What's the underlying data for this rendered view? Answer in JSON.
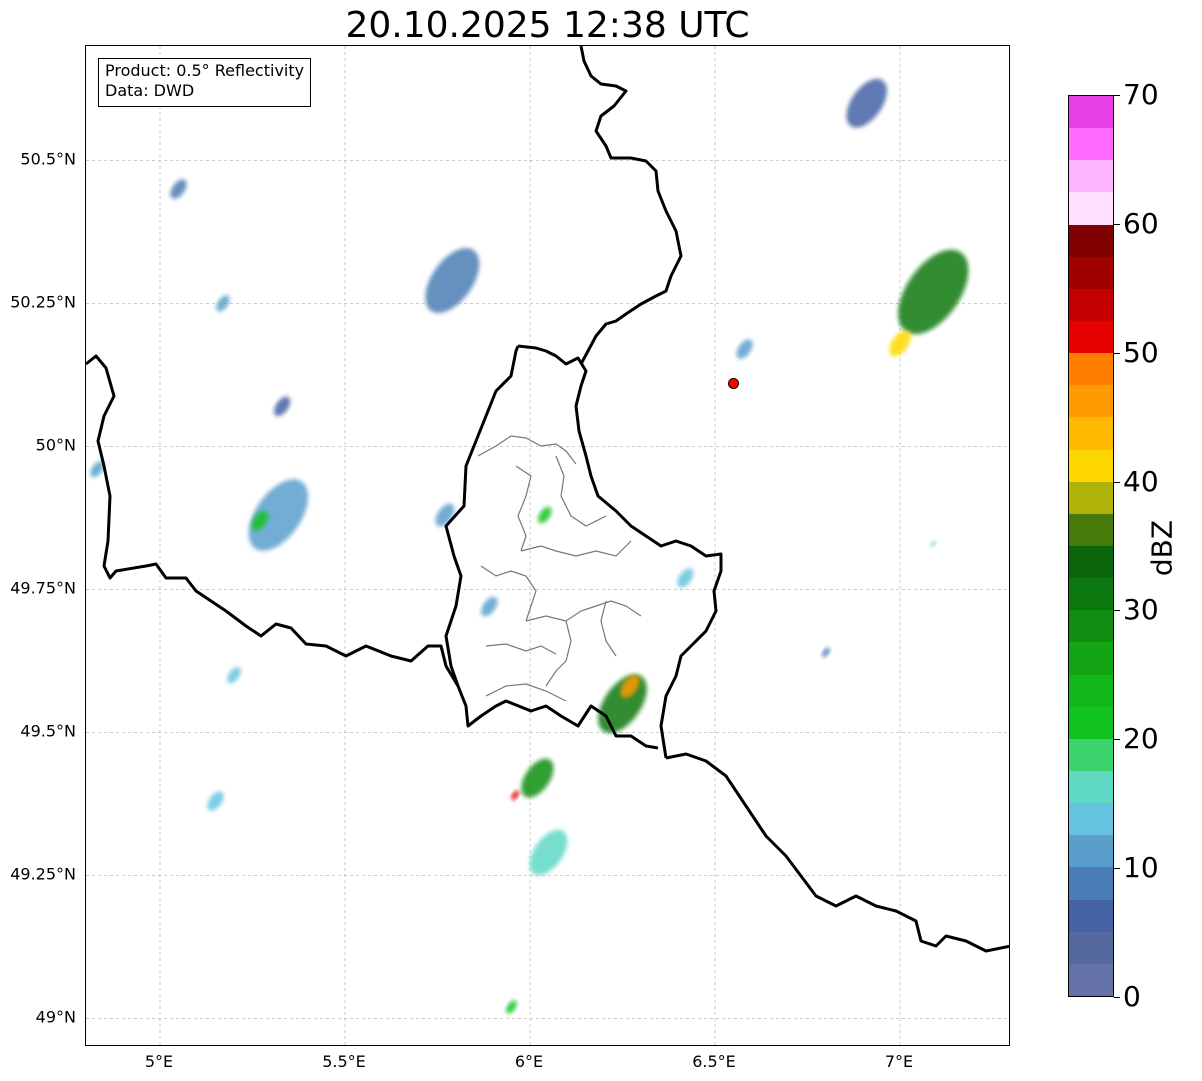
{
  "title": "20.10.2025 12:38 UTC",
  "info_box": {
    "line1": "Product: 0.5° Reflectivity",
    "line2": "Data: DWD"
  },
  "axes": {
    "lon_range": [
      4.8,
      7.3
    ],
    "lat_range": [
      48.95,
      50.7
    ],
    "lon_ticks": [
      {
        "value": 5.0,
        "label": "5°E"
      },
      {
        "value": 5.5,
        "label": "5.5°E"
      },
      {
        "value": 6.0,
        "label": "6°E"
      },
      {
        "value": 6.5,
        "label": "6.5°E"
      },
      {
        "value": 7.0,
        "label": "7°E"
      }
    ],
    "lat_ticks": [
      {
        "value": 49.0,
        "label": "49°N"
      },
      {
        "value": 49.25,
        "label": "49.25°N"
      },
      {
        "value": 49.5,
        "label": "49.5°N"
      },
      {
        "value": 49.75,
        "label": "49.75°N"
      },
      {
        "value": 50.0,
        "label": "50°N"
      },
      {
        "value": 50.25,
        "label": "50.25°N"
      },
      {
        "value": 50.5,
        "label": "50.5°N"
      }
    ]
  },
  "radar_site": {
    "lon": 6.55,
    "lat": 50.11,
    "color": "#ff0000"
  },
  "colorbar": {
    "unit": "dBZ",
    "min": 0,
    "max": 70,
    "ticks": [
      {
        "value": 0,
        "label": "0"
      },
      {
        "value": 10,
        "label": "10"
      },
      {
        "value": 20,
        "label": "20"
      },
      {
        "value": 30,
        "label": "30"
      },
      {
        "value": 40,
        "label": "40"
      },
      {
        "value": 50,
        "label": "50"
      },
      {
        "value": 60,
        "label": "60"
      },
      {
        "value": 70,
        "label": "70"
      }
    ],
    "colors": [
      "#6673a8",
      "#5568a0",
      "#4462a4",
      "#4a7db5",
      "#5a9fcb",
      "#66c3df",
      "#5fd8c4",
      "#3dd46e",
      "#12c31e",
      "#12b81a",
      "#13a514",
      "#0f8e12",
      "#0c7810",
      "#0b650d",
      "#467a0b",
      "#afb309",
      "#ffd700",
      "#ffb900",
      "#ff9a00",
      "#ff7e00",
      "#e60000",
      "#c40000",
      "#a10000",
      "#800000",
      "#ffe0ff",
      "#ffb4ff",
      "#ff6cff",
      "#e83ee8"
    ]
  },
  "echoes": [
    {
      "lon": 6.25,
      "lat": 49.55,
      "size": 0.18,
      "dbz": 30
    },
    {
      "lon": 6.27,
      "lat": 49.58,
      "size": 0.07,
      "dbz": 45
    },
    {
      "lon": 6.02,
      "lat": 49.42,
      "size": 0.12,
      "dbz": 28
    },
    {
      "lon": 5.96,
      "lat": 49.39,
      "size": 0.03,
      "dbz": 52
    },
    {
      "lon": 6.05,
      "lat": 49.29,
      "size": 0.14,
      "dbz": 15
    },
    {
      "lon": 5.32,
      "lat": 49.88,
      "size": 0.22,
      "dbz": 12
    },
    {
      "lon": 5.27,
      "lat": 49.87,
      "size": 0.06,
      "dbz": 22
    },
    {
      "lon": 5.79,
      "lat": 50.29,
      "size": 0.2,
      "dbz": 8
    },
    {
      "lon": 7.09,
      "lat": 50.27,
      "size": 0.26,
      "dbz": 30
    },
    {
      "lon": 7.0,
      "lat": 50.18,
      "size": 0.08,
      "dbz": 42
    },
    {
      "lon": 6.91,
      "lat": 50.6,
      "size": 0.15,
      "dbz": 6
    },
    {
      "lon": 5.05,
      "lat": 50.45,
      "size": 0.06,
      "dbz": 8
    },
    {
      "lon": 5.17,
      "lat": 50.25,
      "size": 0.05,
      "dbz": 10
    },
    {
      "lon": 5.77,
      "lat": 49.88,
      "size": 0.07,
      "dbz": 10
    },
    {
      "lon": 6.04,
      "lat": 49.88,
      "size": 0.05,
      "dbz": 20
    },
    {
      "lon": 5.33,
      "lat": 50.07,
      "size": 0.06,
      "dbz": 6
    },
    {
      "lon": 5.2,
      "lat": 49.6,
      "size": 0.05,
      "dbz": 14
    },
    {
      "lon": 5.15,
      "lat": 49.38,
      "size": 0.06,
      "dbz": 14
    },
    {
      "lon": 6.42,
      "lat": 49.77,
      "size": 0.06,
      "dbz": 14
    },
    {
      "lon": 6.8,
      "lat": 49.64,
      "size": 0.03,
      "dbz": 8
    },
    {
      "lon": 7.09,
      "lat": 49.83,
      "size": 0.02,
      "dbz": 16
    },
    {
      "lon": 5.89,
      "lat": 49.72,
      "size": 0.06,
      "dbz": 12
    },
    {
      "lon": 6.58,
      "lat": 50.17,
      "size": 0.06,
      "dbz": 10
    },
    {
      "lon": 4.83,
      "lat": 49.96,
      "size": 0.05,
      "dbz": 10
    },
    {
      "lon": 5.95,
      "lat": 49.02,
      "size": 0.04,
      "dbz": 20
    }
  ]
}
